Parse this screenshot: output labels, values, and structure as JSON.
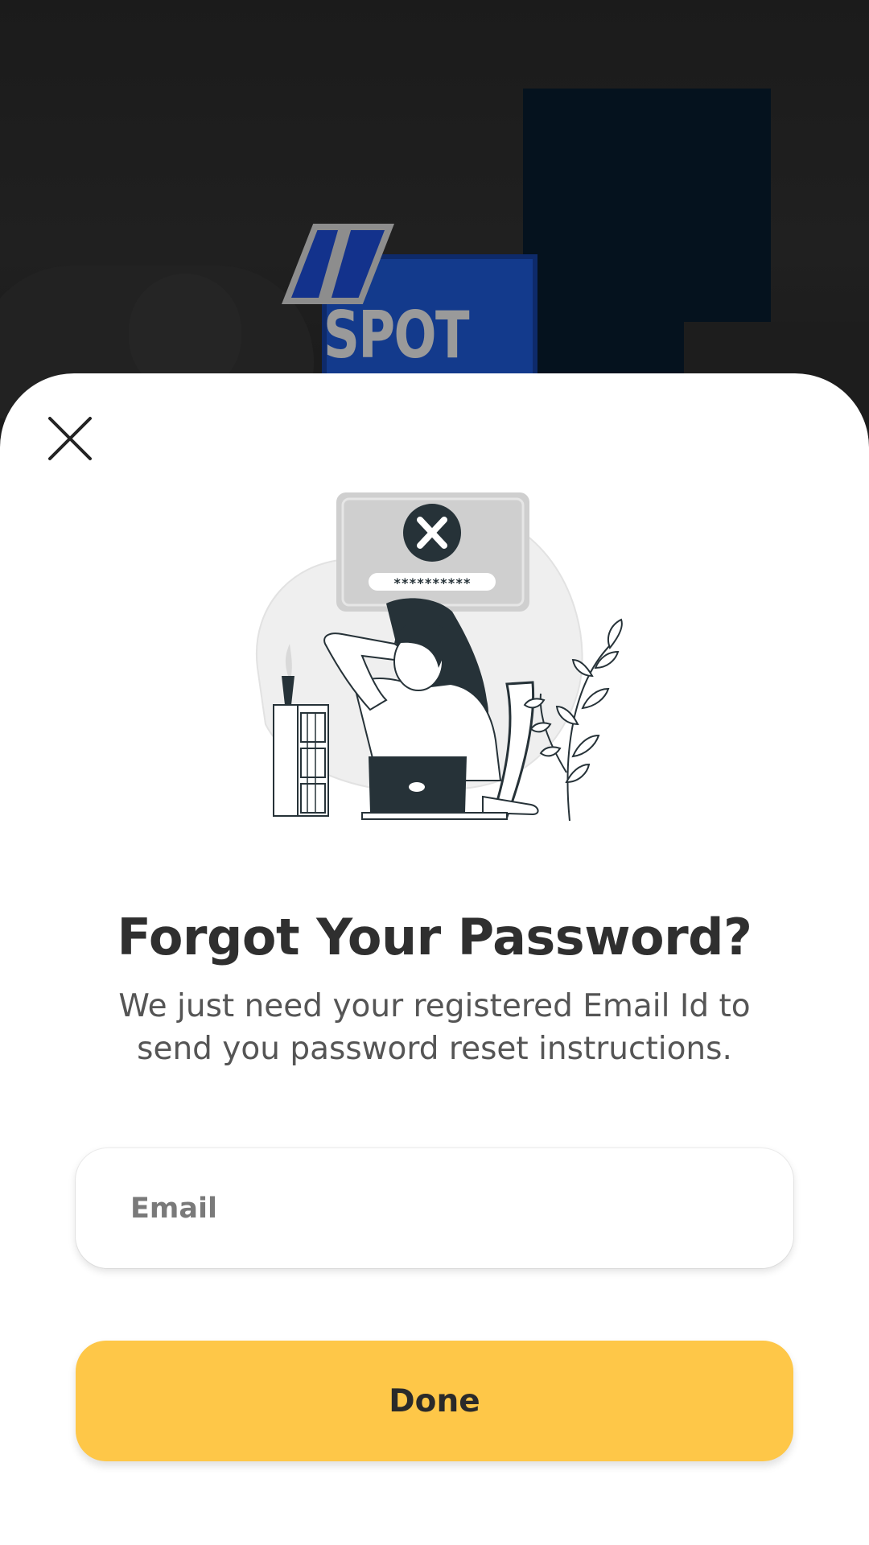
{
  "background": {
    "logo_text": "SPOT",
    "brand_color": "#133a8c"
  },
  "sheet": {
    "close_icon": "close-icon",
    "illustration": {
      "name": "forgot-password-illustration",
      "password_mask": "**********",
      "status_icon": "x-circle-icon"
    },
    "title": "Forgot Your Password?",
    "subtitle_line1": "We just need your registered Email Id to",
    "subtitle_line2": "send you password reset instructions.",
    "email": {
      "placeholder": "Email",
      "value": ""
    },
    "done_label": "Done",
    "accent_color": "#fec748"
  }
}
